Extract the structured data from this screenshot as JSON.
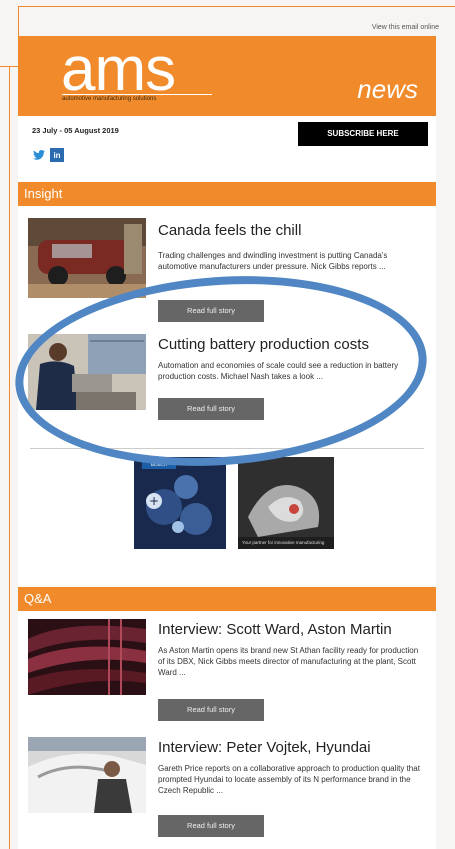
{
  "view_online": "View this email online",
  "header": {
    "logo": "ams",
    "logo_subtitle": "automotive manufacturing solutions",
    "news": "news"
  },
  "date_range": "23 July - 05 August 2019",
  "subscribe_label": "SUBSCRIBE HERE",
  "social": {
    "twitter_icon": "twitter-icon",
    "linkedin_icon": "linkedin-icon",
    "linkedin_label": "in"
  },
  "sections": {
    "insight": "Insight",
    "qa": "Q&A"
  },
  "articles": [
    {
      "title": "Canada feels the chill",
      "desc": "Trading challenges and dwindling investment is putting Canada's automotive manufacturers under pressure. Nick Gibbs reports ...",
      "button": "Read full story"
    },
    {
      "title": "Cutting battery production costs",
      "desc": "Automation and economies of scale could see a reduction in battery production costs. Michael Nash takes a look ...",
      "button": "Read full story"
    },
    {
      "title": "Interview: Scott Ward, Aston Martin",
      "desc": "As Aston Martin opens its brand new St Athan facility ready for production of its DBX, Nick Gibbs meets director of manufacturing at the plant, Scott Ward ...",
      "button": "Read full story"
    },
    {
      "title": "Interview: Peter Vojtek, Hyundai",
      "desc": "Gareth Price reports on a collaborative approach to production quality that prompted Hyundai to locate assembly of its N performance brand in the Czech Republic ...",
      "button": "Read full story"
    }
  ],
  "ads": {
    "ad1_tag": "BOSCH",
    "ad2_caption": "Your partner for innovative manufacturing"
  },
  "colors": {
    "brand_orange": "#f08a2b",
    "annotation_blue": "#4f86c3"
  }
}
